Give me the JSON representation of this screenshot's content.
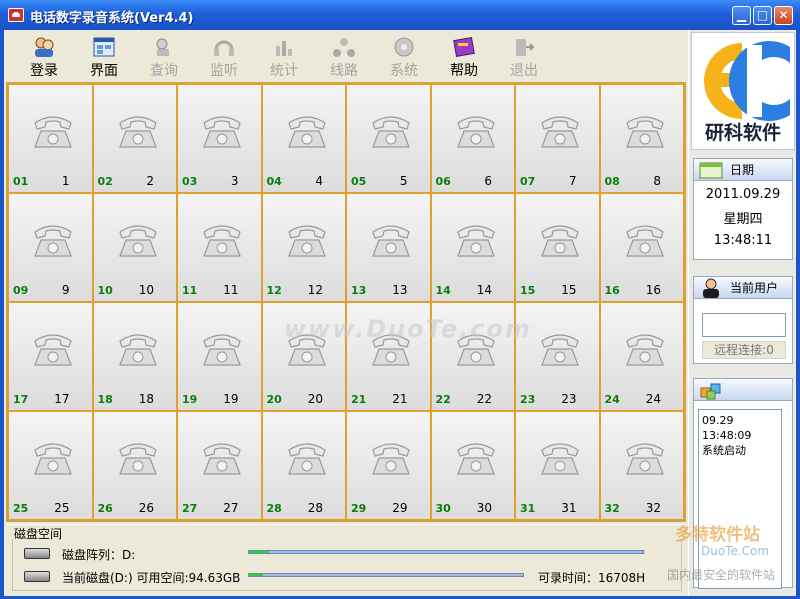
{
  "window": {
    "title": "电话数字录音系统(Ver4.4)",
    "minimize": "▁",
    "maximize": "□",
    "close": "✕"
  },
  "toolbar": [
    {
      "label": "登录",
      "icon": "users-icon",
      "enabled": true
    },
    {
      "label": "界面",
      "icon": "grid-window-icon",
      "enabled": true
    },
    {
      "label": "查询",
      "icon": "search-person-icon",
      "enabled": false
    },
    {
      "label": "监听",
      "icon": "headset-icon",
      "enabled": false
    },
    {
      "label": "统计",
      "icon": "bar-chart-icon",
      "enabled": false
    },
    {
      "label": "线路",
      "icon": "network-icon",
      "enabled": false
    },
    {
      "label": "系统",
      "icon": "settings-disc-icon",
      "enabled": false
    },
    {
      "label": "帮助",
      "icon": "help-book-icon",
      "enabled": true
    },
    {
      "label": "退出",
      "icon": "exit-icon",
      "enabled": false
    }
  ],
  "channels": [
    {
      "ch": "01",
      "n": "1"
    },
    {
      "ch": "02",
      "n": "2"
    },
    {
      "ch": "03",
      "n": "3"
    },
    {
      "ch": "04",
      "n": "4"
    },
    {
      "ch": "05",
      "n": "5"
    },
    {
      "ch": "06",
      "n": "6"
    },
    {
      "ch": "07",
      "n": "7"
    },
    {
      "ch": "08",
      "n": "8"
    },
    {
      "ch": "09",
      "n": "9"
    },
    {
      "ch": "10",
      "n": "10"
    },
    {
      "ch": "11",
      "n": "11"
    },
    {
      "ch": "12",
      "n": "12"
    },
    {
      "ch": "13",
      "n": "13"
    },
    {
      "ch": "14",
      "n": "14"
    },
    {
      "ch": "15",
      "n": "15"
    },
    {
      "ch": "16",
      "n": "16"
    },
    {
      "ch": "17",
      "n": "17"
    },
    {
      "ch": "18",
      "n": "18"
    },
    {
      "ch": "19",
      "n": "19"
    },
    {
      "ch": "20",
      "n": "20"
    },
    {
      "ch": "21",
      "n": "21"
    },
    {
      "ch": "22",
      "n": "22"
    },
    {
      "ch": "23",
      "n": "23"
    },
    {
      "ch": "24",
      "n": "24"
    },
    {
      "ch": "25",
      "n": "25"
    },
    {
      "ch": "26",
      "n": "26"
    },
    {
      "ch": "27",
      "n": "27"
    },
    {
      "ch": "28",
      "n": "28"
    },
    {
      "ch": "29",
      "n": "29"
    },
    {
      "ch": "30",
      "n": "30"
    },
    {
      "ch": "31",
      "n": "31"
    },
    {
      "ch": "32",
      "n": "32"
    }
  ],
  "disk": {
    "legend": "磁盘空间",
    "array_label": "磁盘阵列：D:",
    "array_used_fraction": 0.05,
    "current_label": "当前磁盘(D:) 可用空间:94.63GB",
    "current_used_fraction": 0.05,
    "record_time": "可录时间：16708H"
  },
  "side": {
    "brand": "研科软件",
    "date_title": "日期",
    "date": "2011.09.29",
    "weekday": "星期四",
    "time": "13:48:11",
    "user_title": "当前用户",
    "user_value": "",
    "remote": "远程连接:0",
    "log": [
      "09.29 13:48:09",
      "系统启动"
    ]
  },
  "watermarks": {
    "center": "www.DuoTe.com",
    "corner_1": "多特软件站",
    "corner_2": "DuoTe.Com",
    "corner_3": "国内最安全的软件站"
  },
  "colors": {
    "titlebar": "#1d5fd8",
    "cell_border": "#e0a030",
    "channel_id": "#0b7d0b",
    "progress": "#2fd12f"
  }
}
